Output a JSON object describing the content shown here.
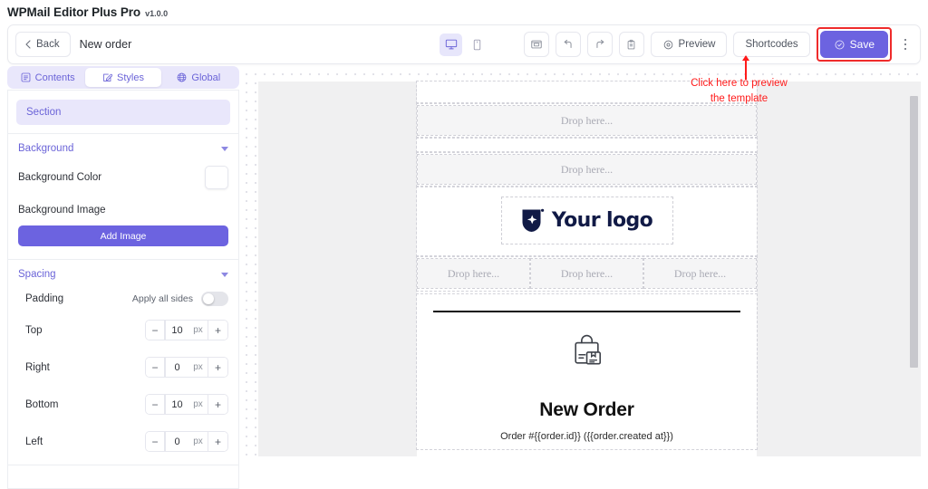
{
  "app": {
    "title": "WPMail Editor Plus Pro",
    "version": "v1.0.0"
  },
  "toolbar": {
    "back_label": "Back",
    "document_name": "New order",
    "device_desktop_icon": "desktop-icon",
    "device_mobile_icon": "mobile-icon",
    "template_icon": "template-save-icon",
    "undo_icon": "undo-icon",
    "redo_icon": "redo-icon",
    "clipboard_icon": "clipboard-icon",
    "preview_label": "Preview",
    "preview_icon": "eye-icon",
    "shortcodes_label": "Shortcodes",
    "save_label": "Save",
    "save_icon": "check-circle-icon",
    "more_icon": "kebab-menu-icon",
    "accent_color": "#6c63e0",
    "highlight_color": "#ef2b2b"
  },
  "sidebar": {
    "tabs": [
      {
        "label": "Contents",
        "icon": "list-icon",
        "active": false
      },
      {
        "label": "Styles",
        "icon": "pencil-square-icon",
        "active": true
      },
      {
        "label": "Global",
        "icon": "globe-icon",
        "active": false
      }
    ],
    "selected_element": "Section",
    "background_group": {
      "title": "Background",
      "color_label": "Background Color",
      "color_value": "#ffffff",
      "image_label": "Background Image",
      "add_image_label": "Add Image"
    },
    "spacing_group": {
      "title": "Spacing",
      "padding_label": "Padding",
      "apply_all_label": "Apply all sides",
      "apply_all_enabled": false,
      "unit": "px",
      "minus_label": "−",
      "plus_label": "+",
      "fields": [
        {
          "label": "Top",
          "value": "10"
        },
        {
          "label": "Right",
          "value": "0"
        },
        {
          "label": "Bottom",
          "value": "10"
        },
        {
          "label": "Left",
          "value": "0"
        }
      ]
    }
  },
  "canvas": {
    "dropzone_label": "Drop here...",
    "logo_text": "Your logo",
    "logo_icon": "shield-spark-logo-icon",
    "order_icon": "shopping-bag-box-icon",
    "order_title": "New Order",
    "order_meta": "Order #{{order.id}} ({{order.created  at}})"
  },
  "annotation": {
    "line1": "Click here to preview",
    "line2": "the template"
  }
}
